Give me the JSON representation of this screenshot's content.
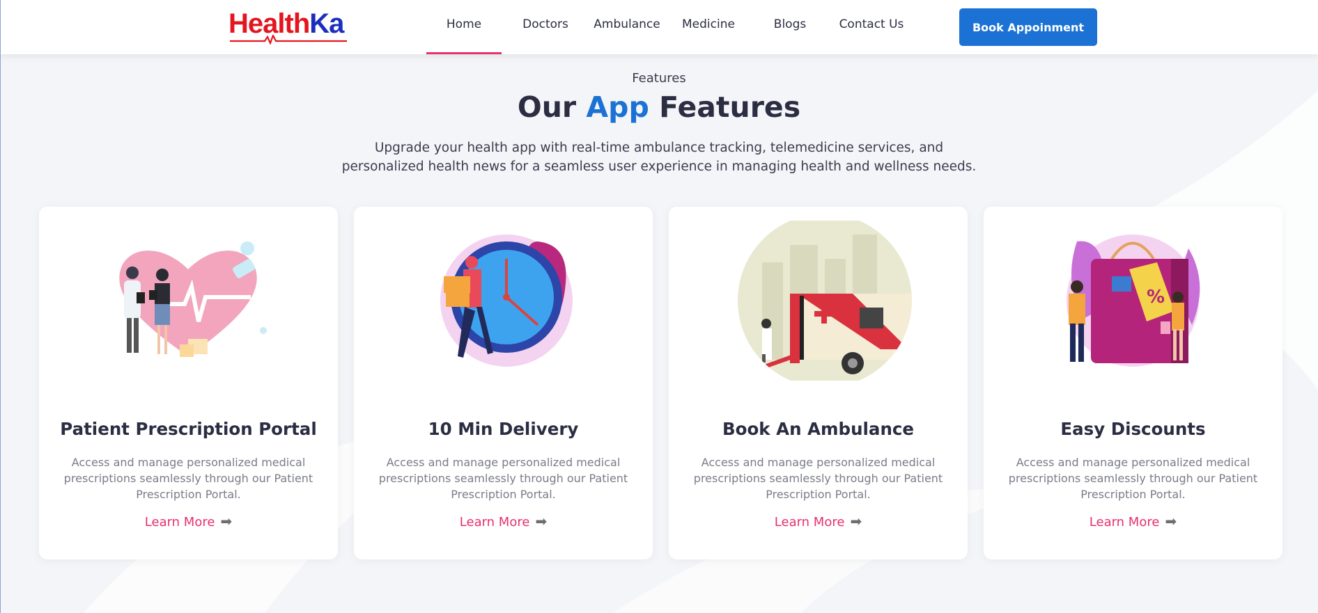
{
  "brand": {
    "name_part1": "Health",
    "name_part2": "Ka",
    "colors": {
      "red": "#e3161f",
      "blue": "#1b2fbf"
    }
  },
  "nav": {
    "items": [
      {
        "label": "Home",
        "active": true
      },
      {
        "label": "Doctors",
        "active": false
      },
      {
        "label": "Ambulance",
        "active": false
      },
      {
        "label": "Medicine",
        "active": false
      },
      {
        "label": "Blogs",
        "active": false
      },
      {
        "label": "Contact Us",
        "active": false
      }
    ],
    "cta_label": "Book Appoinment",
    "active_underline_color": "#e8306a",
    "cta_color": "#1c72d4"
  },
  "features": {
    "eyebrow": "Features",
    "title_prefix": "Our ",
    "title_accent": "App",
    "title_suffix": " Features",
    "subtitle": "Upgrade your health app with real-time ambulance tracking, telemedicine services, and personalized health news for a seamless user experience in managing health and wellness needs.",
    "cards": [
      {
        "title": "Patient Prescription Portal",
        "description": "Access and manage personalized medical prescriptions seamlessly through our Patient Prescription Portal.",
        "link": "Learn More",
        "icon": "doctors-heart-illustration"
      },
      {
        "title": "10 Min Delivery",
        "description": "Access and manage personalized medical prescriptions seamlessly through our Patient Prescription Portal.",
        "link": "Learn More",
        "icon": "delivery-clock-illustration"
      },
      {
        "title": "Book An Ambulance",
        "description": "Access and manage personalized medical prescriptions seamlessly through our Patient Prescription Portal.",
        "link": "Learn More",
        "icon": "ambulance-illustration"
      },
      {
        "title": "Easy Discounts",
        "description": "Access and manage personalized medical prescriptions seamlessly through our Patient Prescription Portal.",
        "link": "Learn More",
        "icon": "discount-bag-illustration"
      }
    ],
    "link_color": "#e8306a"
  }
}
